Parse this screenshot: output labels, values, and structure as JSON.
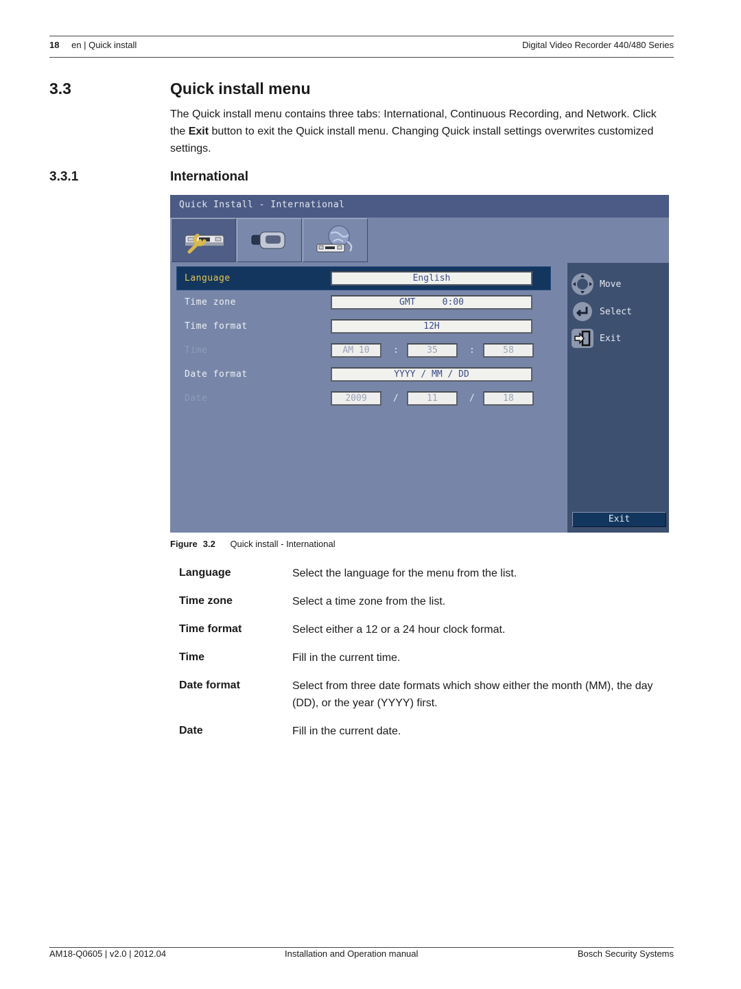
{
  "header": {
    "page_number": "18",
    "section": "en | Quick install",
    "product": "Digital Video Recorder 440/480 Series"
  },
  "section": {
    "number": "3.3",
    "title": "Quick install menu",
    "intro_pre": "The Quick install menu contains three tabs: International, Continuous Recording, and Network. Click the ",
    "intro_bold": "Exit",
    "intro_post": " button to exit the Quick install menu. Changing Quick install settings overwrites customized settings."
  },
  "subsection": {
    "number": "3.3.1",
    "title": "International"
  },
  "dvr_screen": {
    "title": "Quick Install - International",
    "tabs": [
      {
        "name": "International",
        "icon": "wrench-recorder-icon",
        "active": true
      },
      {
        "name": "Continuous Recording",
        "icon": "camera-icon",
        "active": false
      },
      {
        "name": "Network",
        "icon": "globe-network-icon",
        "active": false
      }
    ],
    "rows": {
      "language": {
        "label": "Language",
        "value": "English"
      },
      "time_zone": {
        "label": "Time zone",
        "value": "GMT     0:00"
      },
      "time_format": {
        "label": "Time format",
        "value": "12H"
      },
      "time": {
        "label": "Time",
        "hour": "AM 10",
        "minute": "35",
        "second": "58",
        "separator": ":"
      },
      "date_format": {
        "label": "Date format",
        "value": "YYYY / MM / DD"
      },
      "date": {
        "label": "Date",
        "year": "2009",
        "month": "11",
        "day": "18",
        "separator": "/"
      }
    },
    "legend": {
      "move": "Move",
      "select": "Select",
      "exit": "Exit"
    },
    "exit_button": "Exit",
    "colors": {
      "title_bar": "#4c5b85",
      "panel": "#7786a8",
      "selected_row": "#13365e",
      "selected_label": "#e8c84a",
      "side_panel": "#3d5070"
    }
  },
  "figure": {
    "label": "Figure",
    "number": "3.2",
    "caption": "Quick install - International"
  },
  "definitions": [
    {
      "term": "Language",
      "description": "Select the language for the menu from the list."
    },
    {
      "term": "Time zone",
      "description": "Select a time zone from the list."
    },
    {
      "term": "Time format",
      "description": "Select either a 12 or a 24 hour clock format."
    },
    {
      "term": "Time",
      "description": "Fill in the current time."
    },
    {
      "term": "Date format",
      "description": "Select from three date formats which show either the month (MM), the day (DD), or the year (YYYY) first."
    },
    {
      "term": "Date",
      "description": "Fill in the current date."
    }
  ],
  "footer": {
    "doc_id": "AM18-Q0605 | v2.0 | 2012.04",
    "doc_type": "Installation and Operation manual",
    "company": "Bosch Security Systems"
  }
}
